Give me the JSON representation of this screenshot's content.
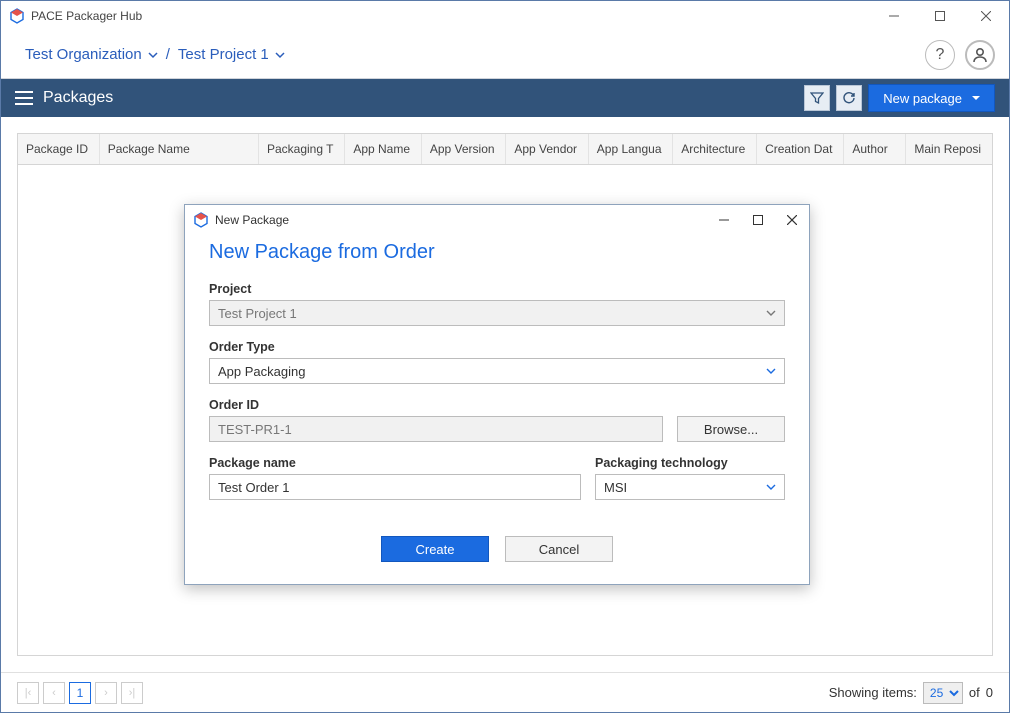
{
  "app": {
    "title": "PACE Packager Hub"
  },
  "breadcrumb": {
    "organization": "Test Organization",
    "project": "Test Project 1"
  },
  "pagebar": {
    "title": "Packages",
    "new_button": "New package"
  },
  "table": {
    "columns": [
      "Package ID",
      "Package Name",
      "Packaging T",
      "App Name",
      "App Version",
      "App Vendor",
      "App Langua",
      "Architecture",
      "Creation Dat",
      "Author",
      "Main Reposi"
    ]
  },
  "footer": {
    "page": "1",
    "showing_label": "Showing items:",
    "page_size": "25",
    "of_label": "of",
    "total": "0"
  },
  "modal": {
    "window_title": "New Package",
    "heading": "New Package from Order",
    "labels": {
      "project": "Project",
      "order_type": "Order Type",
      "order_id": "Order ID",
      "package_name": "Package name",
      "packaging_tech": "Packaging technology"
    },
    "values": {
      "project": "Test Project 1",
      "order_type": "App Packaging",
      "order_id": "TEST-PR1-1",
      "package_name": "Test Order 1",
      "packaging_tech": "MSI"
    },
    "buttons": {
      "browse": "Browse...",
      "create": "Create",
      "cancel": "Cancel"
    }
  }
}
